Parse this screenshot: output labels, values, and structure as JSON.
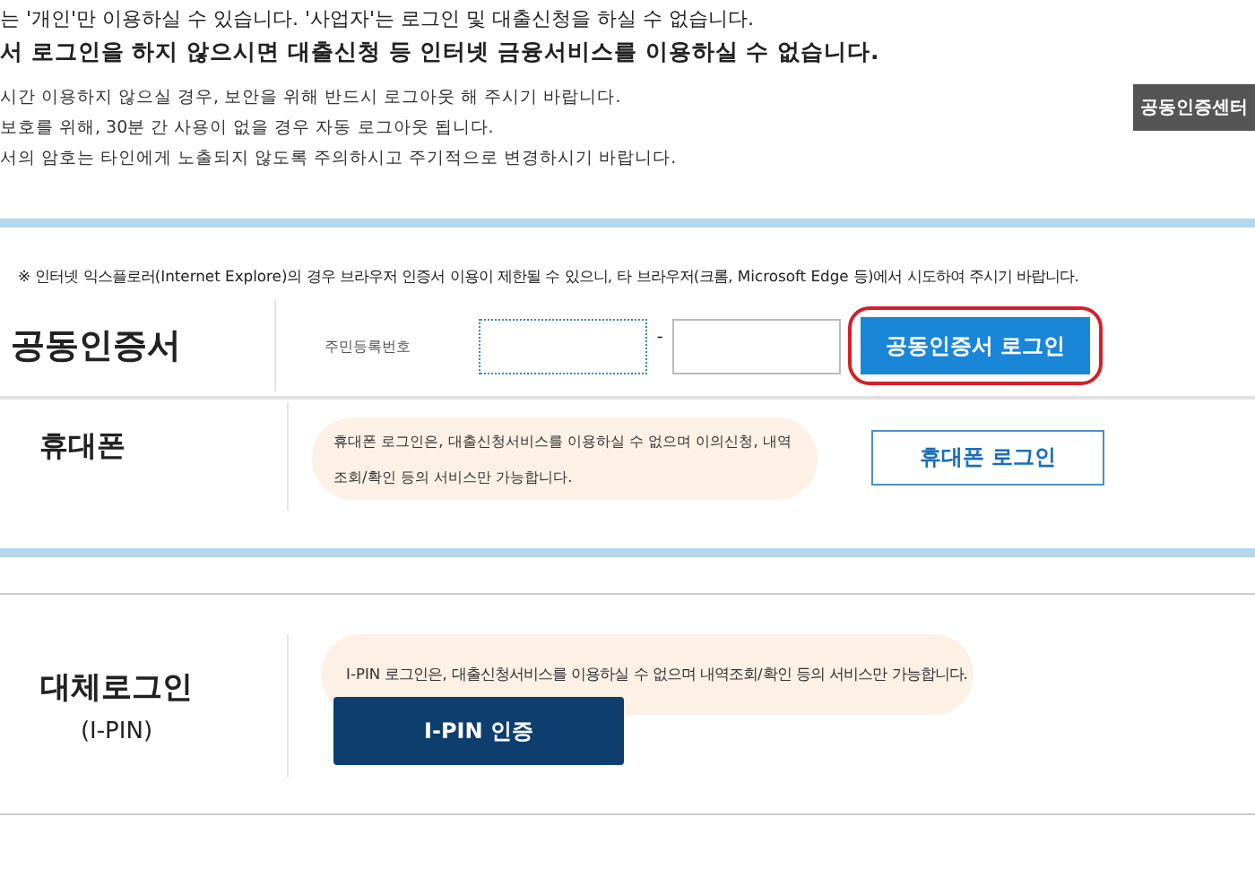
{
  "notice": {
    "lines": [
      {
        "text": "는 '개인'만 이용하실 수 있습니다. '사업자'는 로그인 및 대출신청을 하실 수 없습니다.",
        "bold": false
      },
      {
        "text": "서 로그인을 하지 않으시면 대출신청 등 인터넷 금융서비스를 이용하실 수 없습니다.",
        "bold": true
      }
    ],
    "tips": [
      "시간 이용하지 않으실 경우, 보안을 위해 반드시 로그아웃 해 주시기 바랍니다.",
      "보호를 위해, 30분 간 사용이 없을 경우 자동 로그아웃 됩니다.",
      "서의 암호는 타인에게 노출되지 않도록 주의하시고 주기적으로 변경하시기 바랍니다."
    ],
    "center_button": "공동인증센터"
  },
  "certificate": {
    "browser_note": "※ 인터넷 익스플로러(Internet Explore)의 경우 브라우저 인증서 이용이 제한될 수 있으니, 타 브라우저(크롬, Microsoft Edge 등)에서 시도하여 주시기 바랍니다.",
    "title": "공동인증서",
    "field_label": "주민등록번호",
    "fields": [
      {
        "focused": true
      },
      {
        "focused": false
      }
    ],
    "separator": "-",
    "login_button": {
      "label": "공동인증서 로그인",
      "highlighted": true
    }
  },
  "phone": {
    "title": "휴대폰",
    "info": "휴대폰 로그인은, 대출신청서비스를 이용하실 수 없으며 이의신청, 내역조회/확인 등의 서비스만 가능합니다.",
    "login_button": "휴대폰 로그인"
  },
  "ipin": {
    "title": "대체로그인",
    "subtitle": "(I-PIN)",
    "info": "I-PIN 로그인은, 대출신청서비스를 이용하실 수 없으며 내역조회/확인 등의 서비스만 가능합니다.",
    "button": "I-PIN 인증"
  }
}
